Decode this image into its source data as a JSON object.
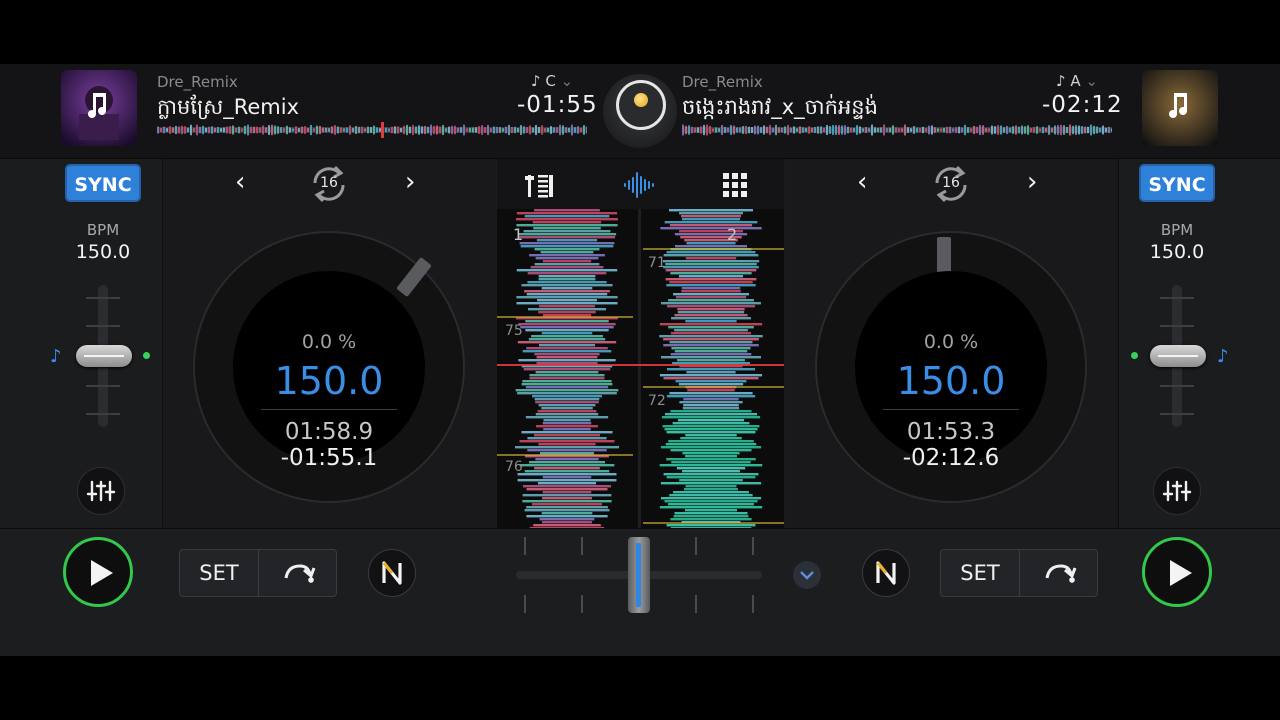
{
  "deck_left": {
    "artist": "Dre_Remix",
    "title": "ក្លាមស្រែ_Remix",
    "key": "C",
    "remaining_header": "-01:55",
    "sync_label": "SYNC",
    "bpm_label": "BPM",
    "bpm_value": "150.0",
    "loop_size": "16",
    "pitch_percent": "0.0 %",
    "tempo": "150.0",
    "elapsed": "01:58.9",
    "remaining": "-01:55.1",
    "set_label": "SET",
    "deck_number": "1",
    "beat_markers": [
      "75",
      "76"
    ],
    "pitch_level": 0.5
  },
  "deck_right": {
    "artist": "Dre_Remix",
    "title": "ចង្កេះរាងរាវ_x_ចាក់អន្ទង់",
    "key": "A",
    "remaining_header": "-02:12",
    "sync_label": "SYNC",
    "bpm_label": "BPM",
    "bpm_value": "150.0",
    "loop_size": "16",
    "pitch_percent": "0.0 %",
    "tempo": "150.0",
    "elapsed": "01:53.3",
    "remaining": "-02:12.6",
    "set_label": "SET",
    "deck_number": "2",
    "beat_markers": [
      "71",
      "72"
    ],
    "pitch_level": 0.5
  },
  "crossfader_position": 0.5,
  "colors": {
    "accent_blue": "#3a8ee6",
    "sync_blue": "#2f80d9",
    "play_green": "#33c84a",
    "background": "#1a1b1d"
  },
  "icons": {
    "mixer": "mixer-icon",
    "waveform": "waveform-icon",
    "pads": "pads-icon",
    "eq": "eq-sliders-icon",
    "loop": "loop-icon",
    "redo": "redo-cue-icon"
  }
}
